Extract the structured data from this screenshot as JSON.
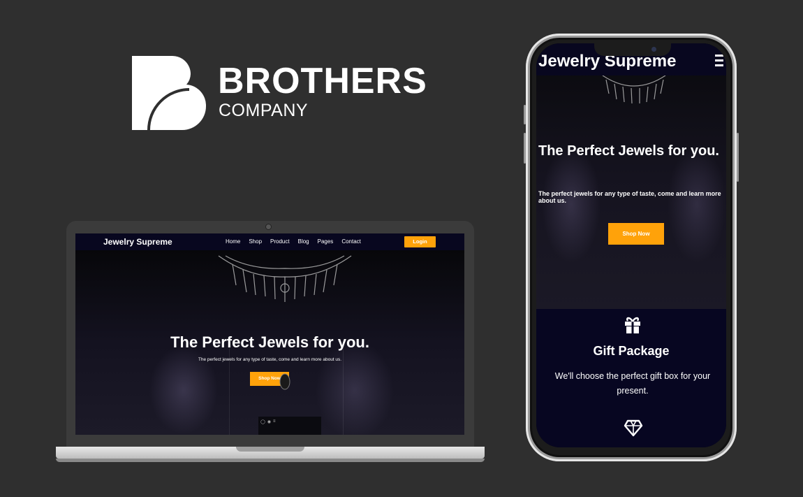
{
  "brand": {
    "name": "BROTHERS",
    "subtitle": "COMPANY"
  },
  "colors": {
    "background": "#2f2f2f",
    "nav_bg": "#08071f",
    "accent": "#ffa20a",
    "card_bg": "#070621"
  },
  "laptop_site": {
    "logo": "Jewelry Supreme",
    "nav": [
      "Home",
      "Shop",
      "Product",
      "Blog",
      "Pages",
      "Contact"
    ],
    "login_label": "Login",
    "hero_title": "The Perfect Jewels for you.",
    "hero_subtitle": "The perfect jewels for any type of taste, come and learn more about us.",
    "shop_button": "Shop Now"
  },
  "phone_site": {
    "logo": "Jewelry Supreme",
    "menu_icon": "hamburger-icon",
    "hero_title": "The Perfect Jewels for you.",
    "hero_subtitle": "The perfect jewels for any type of taste, come and learn more about us.",
    "shop_button": "Shop Now",
    "feature": {
      "icon": "gift-icon",
      "title": "Gift Package",
      "text": "We'll choose the perfect gift box for your present."
    },
    "next_icon": "diamond-icon"
  }
}
